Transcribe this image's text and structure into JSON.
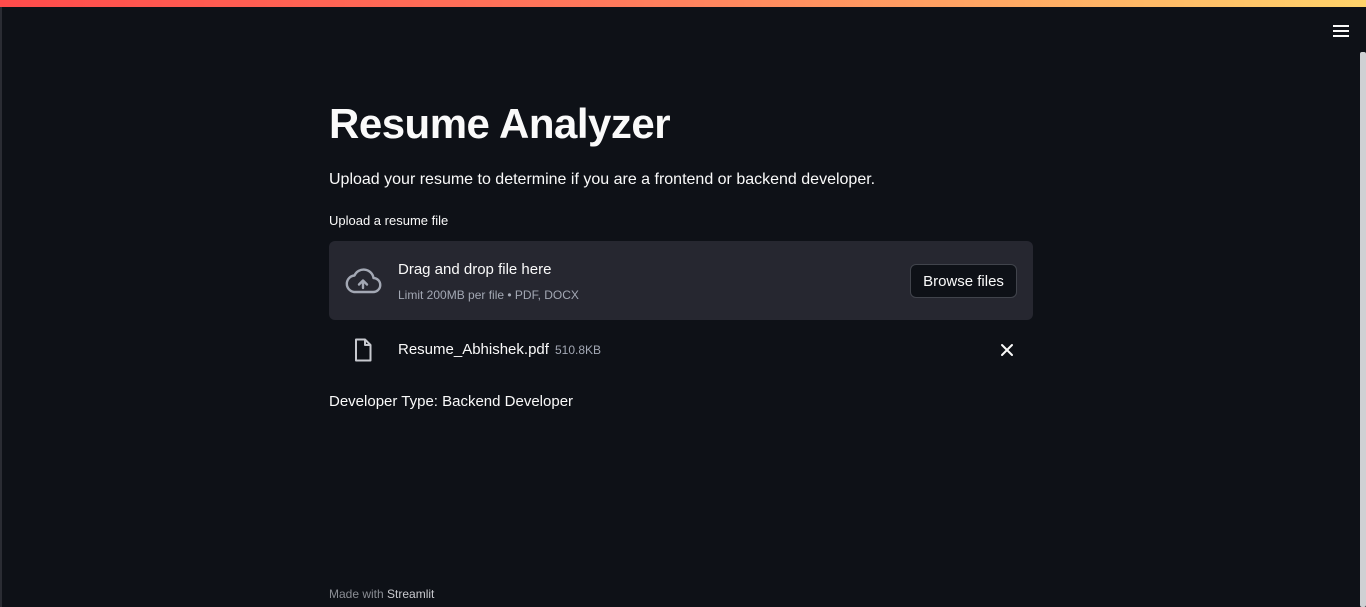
{
  "header": {
    "menu_icon": "hamburger-menu-icon",
    "accent_gradient": [
      "#ff4b4b",
      "#ff7a5c",
      "#ffd36b"
    ]
  },
  "main": {
    "title": "Resume Analyzer",
    "subtitle": "Upload your resume to determine if you are a frontend or backend developer.",
    "uploader": {
      "label": "Upload a resume file",
      "drop_text": "Drag and drop file here",
      "limit_text": "Limit 200MB per file • PDF, DOCX",
      "browse_label": "Browse files",
      "icon": "cloud-upload-icon"
    },
    "uploaded_file": {
      "name": "Resume_Abhishek.pdf",
      "size": "510.8KB",
      "icon": "file-icon",
      "remove_icon": "close-icon"
    },
    "result_text": "Developer Type: Backend Developer"
  },
  "footer": {
    "prefix": "Made with",
    "brand": "Streamlit"
  },
  "colors": {
    "background": "#0e1117",
    "dropzone": "#262730",
    "text": "#fafafa",
    "muted": "#a3a8b4"
  }
}
